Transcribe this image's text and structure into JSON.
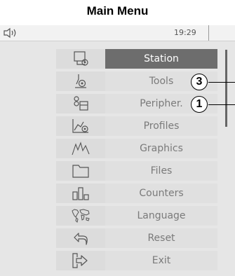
{
  "heading": "Main Menu",
  "status": {
    "time": "19:29"
  },
  "menu": {
    "items": [
      {
        "label": "Station",
        "icon": "station-icon",
        "selected": true
      },
      {
        "label": "Tools",
        "icon": "tools-icon"
      },
      {
        "label": "Peripher.",
        "icon": "peripherals-icon"
      },
      {
        "label": "Profiles",
        "icon": "profiles-icon"
      },
      {
        "label": "Graphics",
        "icon": "graphics-icon"
      },
      {
        "label": "Files",
        "icon": "folder-icon"
      },
      {
        "label": "Counters",
        "icon": "counters-icon"
      },
      {
        "label": "Language",
        "icon": "world-map-icon"
      },
      {
        "label": "Reset",
        "icon": "reset-arrow-icon"
      },
      {
        "label": "Exit",
        "icon": "exit-icon"
      }
    ]
  },
  "callouts": [
    {
      "number": "3",
      "target": "Tools"
    },
    {
      "number": "1",
      "target": "Peripher."
    }
  ],
  "colors": {
    "screen_bg": "#e6e6e6",
    "selected_bg": "#6d6d6d",
    "label_text": "#7a7a7a"
  }
}
